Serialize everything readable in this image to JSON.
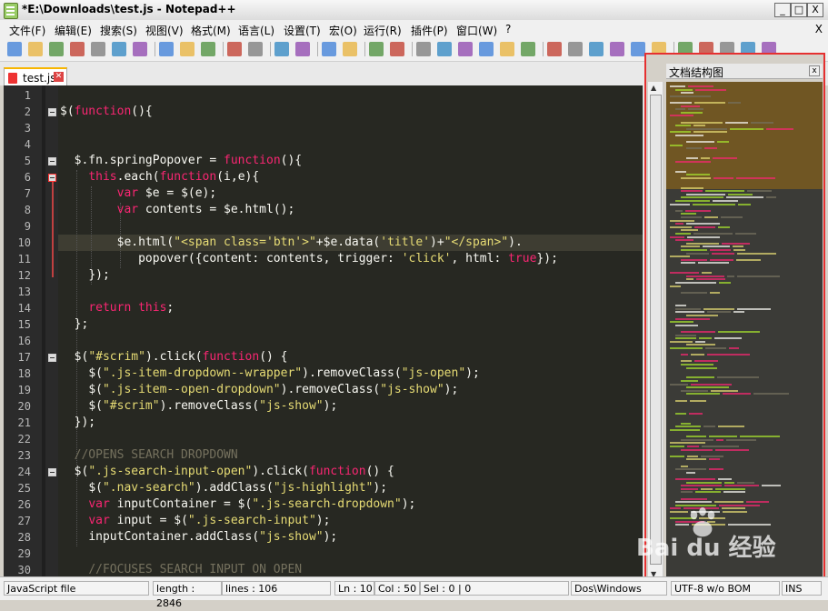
{
  "window": {
    "title": "*E:\\Downloads\\test.js - Notepad++",
    "minimize": "_",
    "maximize": "□",
    "close": "X"
  },
  "menu": [
    "文件(F)",
    "编辑(E)",
    "搜索(S)",
    "视图(V)",
    "格式(M)",
    "语言(L)",
    "设置(T)",
    "宏(O)",
    "运行(R)",
    "插件(P)",
    "窗口(W)",
    "?"
  ],
  "menu_close": "X",
  "toolbar_icons": [
    "new-file-icon",
    "open-file-icon",
    "save-icon",
    "save-all-icon",
    "close-icon",
    "close-all-icon",
    "print-icon",
    "cut-icon",
    "copy-icon",
    "paste-icon",
    "undo-icon",
    "redo-icon",
    "find-icon",
    "replace-icon",
    "zoom-in-icon",
    "zoom-out-icon",
    "sync-v-icon",
    "sync-h-icon",
    "wrap-icon",
    "all-chars-icon",
    "indent-guide-icon",
    "doc-map-icon",
    "function-list-icon",
    "folder-icon",
    "record-macro-icon",
    "stop-macro-icon",
    "play-macro-icon",
    "run-macro-icon",
    "save-macro-icon",
    "trim-icon",
    "up-icon",
    "down-icon",
    "spell-icon",
    "abc-icon",
    "h-icon"
  ],
  "tab": {
    "label": "test.js",
    "close": "✕"
  },
  "editor": {
    "lines": [
      {
        "n": "1",
        "fold": "",
        "segs": []
      },
      {
        "n": "2",
        "fold": "open",
        "segs": [
          [
            "$(",
            "p"
          ],
          [
            "function",
            "kw"
          ],
          [
            "(){",
            "p"
          ]
        ]
      },
      {
        "n": "3",
        "fold": "",
        "segs": []
      },
      {
        "n": "4",
        "fold": "",
        "segs": []
      },
      {
        "n": "5",
        "fold": "open",
        "segs": [
          "  ",
          [
            "$.fn.springPopover = ",
            "p"
          ],
          [
            "function",
            "kw"
          ],
          [
            "(){",
            "p"
          ]
        ]
      },
      {
        "n": "6",
        "fold": "red",
        "segs": [
          "    ",
          [
            "this",
            "kw"
          ],
          [
            ".each(",
            "p"
          ],
          [
            "function",
            "kw"
          ],
          [
            "(i,e){",
            "p"
          ]
        ]
      },
      {
        "n": "7",
        "fold": "",
        "segs": [
          "        ",
          [
            "var",
            "kw"
          ],
          [
            " $e = $(e);",
            "p"
          ]
        ]
      },
      {
        "n": "8",
        "fold": "",
        "segs": [
          "        ",
          [
            "var",
            "kw"
          ],
          [
            " contents = $e.html();",
            "p"
          ]
        ]
      },
      {
        "n": "9",
        "fold": "",
        "segs": []
      },
      {
        "n": "10",
        "fold": "",
        "segs": [
          "        ",
          [
            "$e.html(",
            "p"
          ],
          [
            "\"<span class='btn'>\"",
            "str"
          ],
          [
            "+$e.data(",
            "p"
          ],
          [
            "'title'",
            "str"
          ],
          [
            ")+",
            "p"
          ],
          [
            "\"</span>\"",
            "str"
          ],
          [
            ").",
            "p"
          ]
        ]
      },
      {
        "n": "11",
        "fold": "",
        "segs": [
          "           ",
          [
            "popover({content: contents, trigger: ",
            "p"
          ],
          [
            "'click'",
            "str"
          ],
          [
            ", html: ",
            "p"
          ],
          [
            "true",
            "kw"
          ],
          [
            "});",
            "p"
          ]
        ]
      },
      {
        "n": "12",
        "fold": "",
        "segs": [
          "    ",
          [
            "});",
            "p"
          ]
        ]
      },
      {
        "n": "13",
        "fold": "",
        "segs": []
      },
      {
        "n": "14",
        "fold": "",
        "segs": [
          "    ",
          [
            "return",
            "kw"
          ],
          [
            " ",
            "p"
          ],
          [
            "this",
            "kw"
          ],
          [
            ";",
            "p"
          ]
        ]
      },
      {
        "n": "15",
        "fold": "",
        "segs": [
          "  ",
          [
            "};",
            "p"
          ]
        ]
      },
      {
        "n": "16",
        "fold": "",
        "segs": []
      },
      {
        "n": "17",
        "fold": "open",
        "segs": [
          "  ",
          [
            "$(",
            "p"
          ],
          [
            "\"#scrim\"",
            "str"
          ],
          [
            ").click(",
            "p"
          ],
          [
            "function",
            "kw"
          ],
          [
            "() {",
            "p"
          ]
        ]
      },
      {
        "n": "18",
        "fold": "",
        "segs": [
          "    ",
          [
            "$(",
            "p"
          ],
          [
            "\".js-item-dropdown--wrapper\"",
            "str"
          ],
          [
            ").removeClass(",
            "p"
          ],
          [
            "\"js-open\"",
            "str"
          ],
          [
            ");",
            "p"
          ]
        ]
      },
      {
        "n": "19",
        "fold": "",
        "segs": [
          "    ",
          [
            "$(",
            "p"
          ],
          [
            "\".js-item--open-dropdown\"",
            "str"
          ],
          [
            ").removeClass(",
            "p"
          ],
          [
            "\"js-show\"",
            "str"
          ],
          [
            ");",
            "p"
          ]
        ]
      },
      {
        "n": "20",
        "fold": "",
        "segs": [
          "    ",
          [
            "$(",
            "p"
          ],
          [
            "\"#scrim\"",
            "str"
          ],
          [
            ").removeClass(",
            "p"
          ],
          [
            "\"js-show\"",
            "str"
          ],
          [
            ");",
            "p"
          ]
        ]
      },
      {
        "n": "21",
        "fold": "",
        "segs": [
          "  ",
          [
            "});",
            "p"
          ]
        ]
      },
      {
        "n": "22",
        "fold": "",
        "segs": []
      },
      {
        "n": "23",
        "fold": "",
        "segs": [
          "  ",
          [
            "//OPENS SEARCH DROPDOWN",
            "cm"
          ]
        ]
      },
      {
        "n": "24",
        "fold": "open",
        "segs": [
          "  ",
          [
            "$(",
            "p"
          ],
          [
            "\".js-search-input-open\"",
            "str"
          ],
          [
            ").click(",
            "p"
          ],
          [
            "function",
            "kw"
          ],
          [
            "() {",
            "p"
          ]
        ]
      },
      {
        "n": "25",
        "fold": "",
        "segs": [
          "    ",
          [
            "$(",
            "p"
          ],
          [
            "\".nav-search\"",
            "str"
          ],
          [
            ").addClass(",
            "p"
          ],
          [
            "\"js-highlight\"",
            "str"
          ],
          [
            ");",
            "p"
          ]
        ]
      },
      {
        "n": "26",
        "fold": "",
        "segs": [
          "    ",
          [
            "var",
            "kw"
          ],
          [
            " inputContainer = $(",
            "p"
          ],
          [
            "\".js-search-dropdown\"",
            "str"
          ],
          [
            ");",
            "p"
          ]
        ]
      },
      {
        "n": "27",
        "fold": "",
        "segs": [
          "    ",
          [
            "var",
            "kw"
          ],
          [
            " input = $(",
            "p"
          ],
          [
            "\".js-search-input\"",
            "str"
          ],
          [
            ");",
            "p"
          ]
        ]
      },
      {
        "n": "28",
        "fold": "",
        "segs": [
          "    ",
          [
            "inputContainer.addClass(",
            "p"
          ],
          [
            "\"js-show\"",
            "str"
          ],
          [
            ");",
            "p"
          ]
        ]
      },
      {
        "n": "29",
        "fold": "",
        "segs": []
      },
      {
        "n": "30",
        "fold": "",
        "segs": [
          "    ",
          [
            "//FOCUSES SEARCH INPUT ON OPEN",
            "cm"
          ]
        ]
      }
    ]
  },
  "docmap": {
    "title": "文档结构图",
    "close": "x"
  },
  "watermark": "Bai du 经验",
  "status": {
    "type": "JavaScript file",
    "length": "length : 2846",
    "lines": "lines : 106",
    "ln": "Ln : 10",
    "col": "Col : 50",
    "sel": "Sel : 0 | 0",
    "eol": "Dos\\Windows",
    "encoding": "UTF-8 w/o BOM",
    "mode": "INS"
  },
  "colors": {
    "keyword": "#f92672",
    "string": "#e6db74",
    "comment": "#75715e",
    "highlight": "#e53030"
  }
}
